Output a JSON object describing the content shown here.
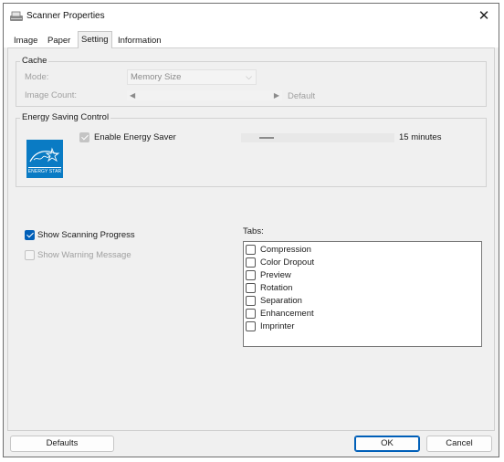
{
  "window": {
    "title": "Scanner Properties",
    "close_glyph": "✕"
  },
  "tabs": [
    "Image",
    "Paper",
    "Setting",
    "Information"
  ],
  "active_tab": "Setting",
  "cache": {
    "group_label": "Cache",
    "mode_label": "Mode:",
    "mode_value": "Memory Size",
    "image_count_label": "Image Count:",
    "image_count_value": "Default"
  },
  "energy": {
    "group_label": "Energy Saving Control",
    "enable_label": "Enable Energy Saver",
    "enable_checked": true,
    "timeout_value": "15 minutes",
    "logo_text": "ENERGY STAR"
  },
  "options": {
    "show_progress_label": "Show Scanning Progress",
    "show_progress_checked": true,
    "show_warning_label": "Show Warning Message",
    "show_warning_checked": false
  },
  "tabs_list": {
    "label": "Tabs:",
    "items": [
      {
        "label": "Compression",
        "checked": false
      },
      {
        "label": "Color Dropout",
        "checked": false
      },
      {
        "label": "Preview",
        "checked": false
      },
      {
        "label": "Rotation",
        "checked": false
      },
      {
        "label": "Separation",
        "checked": false
      },
      {
        "label": "Enhancement",
        "checked": false
      },
      {
        "label": "Imprinter",
        "checked": false
      }
    ]
  },
  "buttons": {
    "defaults": "Defaults",
    "ok": "OK",
    "cancel": "Cancel"
  },
  "colors": {
    "accent": "#005fb8",
    "energy_star": "#0a7bc4"
  }
}
